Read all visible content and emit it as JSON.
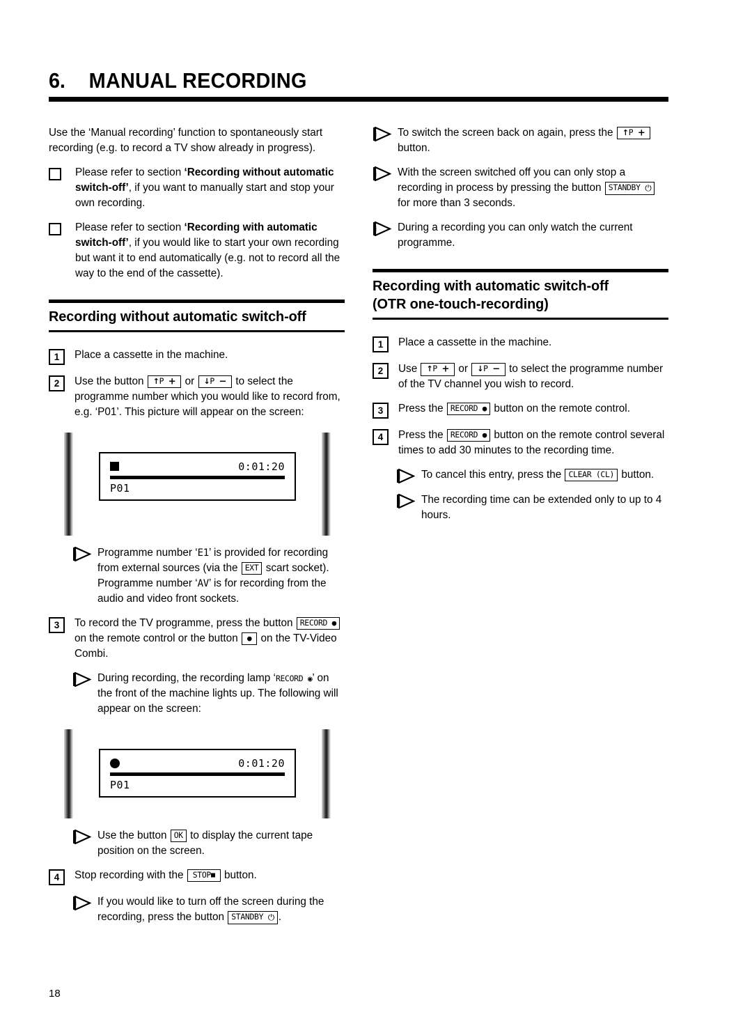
{
  "chapter": {
    "number": "6.",
    "title": "MANUAL RECORDING"
  },
  "left_column": {
    "intro": "Use the ‘Manual recording’ function to spontaneously start recording (e.g. to record a TV show already in progress).",
    "bullets": [
      {
        "text_before": "Please refer to section ",
        "bold": "‘Recording without automatic switch-off’",
        "text_after": ", if you want to manually start and stop your own recording."
      },
      {
        "text_before": "Please refer to section ",
        "bold": "‘Recording with automatic switch-off’",
        "text_after": ", if you would like to start your own recording but want it to end automatically (e.g. not to record all the way to the end of the cassette)."
      }
    ],
    "section_heading": "Recording without automatic switch-off",
    "step1": {
      "number": "1",
      "text": "Place a cassette in the machine."
    },
    "step2": {
      "number": "2",
      "part1": "Use the button",
      "key_up": "P",
      "key_up_sign": "+",
      "or": "or",
      "key_down": "P",
      "key_down_sign": "−",
      "part2": "to select the programme number which you would like to record from, e.g. ‘P01’. This picture will appear on the screen:"
    },
    "figure1": {
      "status_icon": "stop-square",
      "time": "0:01:20",
      "programme": "P01"
    },
    "tip1": {
      "part1": "Programme number ‘",
      "code1": "E1",
      "part2": "’ is provided for recording from external sources (via the",
      "key": "EXT",
      "part3": "scart socket). Programme number ‘",
      "code2": "AV",
      "part4": "’ is for recording from the audio and video front sockets."
    },
    "step3": {
      "number": "3",
      "part1": "To record the TV programme, press the button",
      "key_record": "RECORD",
      "part2": "on the remote control or the button",
      "key_dot": "●",
      "part3": "on the TV-Video Combi."
    },
    "tip2": {
      "part1": "During recording, the recording lamp ‘",
      "lamp_label": "RECORD",
      "part2": "’ on the front of the machine lights up. The following will appear on the screen:"
    },
    "figure2": {
      "status_icon": "record-dot",
      "time": "0:01:20",
      "programme": "P01"
    },
    "tip3": {
      "part1": "Use the button",
      "key": "OK",
      "part2": "to display the current tape position on the screen."
    },
    "step4": {
      "number": "4",
      "part1": "Stop recording with the",
      "key_stop": "STOP",
      "part2": "button."
    },
    "tip4": {
      "part1": "If you would like to turn off the screen during the recording, press the button",
      "key_standby": "STANDBY",
      "part2": "."
    }
  },
  "right_column": {
    "tip1": {
      "part1": "To switch the screen back on again, press the",
      "key_up": "P",
      "key_up_sign": "+",
      "part2": "button."
    },
    "tip2": {
      "part1": "With the screen switched off you can only stop a recording in process by pressing the button",
      "key_standby": "STANDBY",
      "part2": "for more than 3 seconds."
    },
    "tip3": {
      "text": "During a recording you can only watch the current programme."
    },
    "section_heading_line1": "Recording with automatic switch-off",
    "section_heading_line2": "(OTR one-touch-recording)",
    "step1": {
      "number": "1",
      "text": "Place a cassette in the machine."
    },
    "step2": {
      "number": "2",
      "part1": "Use",
      "key_up": "P",
      "key_up_sign": "+",
      "or": "or",
      "key_down": "P",
      "key_down_sign": "−",
      "part2": "to select the programme number of the TV channel you wish to record."
    },
    "step3": {
      "number": "3",
      "part1": "Press the",
      "key_record": "RECORD",
      "part2": "button on the remote control."
    },
    "step4": {
      "number": "4",
      "part1": "Press the",
      "key_record": "RECORD",
      "part2": "button on the remote control several times to add 30 minutes to the recording time."
    },
    "tip4": {
      "part1": "To cancel this entry, press the",
      "key_clear": "CLEAR (CL)",
      "part2": "button."
    },
    "tip5": {
      "text": "The recording time can be extended only to up to 4 hours."
    }
  },
  "footer": {
    "page_number": "18"
  }
}
